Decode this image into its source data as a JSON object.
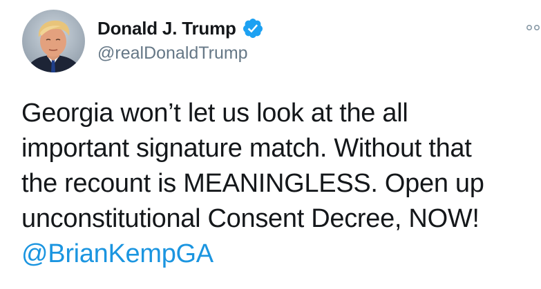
{
  "tweet": {
    "author": {
      "display_name": "Donald J. Trump",
      "handle": "@realDonaldTrump",
      "verified": true
    },
    "text_lines": [
      "Georgia won’t let us look at the all",
      "important signature match. Without that",
      "the recount is MEANINGLESS. Open up",
      "unconstitutional Consent Decree, NOW!"
    ],
    "mention": "@BrianKempGA"
  },
  "icons": {
    "verified": "verified-badge-icon",
    "more": "more-options-icon"
  },
  "colors": {
    "text": "#14171a",
    "secondary": "#657786",
    "link": "#1b95e0",
    "verified": "#1da1f2",
    "background": "#ffffff"
  }
}
